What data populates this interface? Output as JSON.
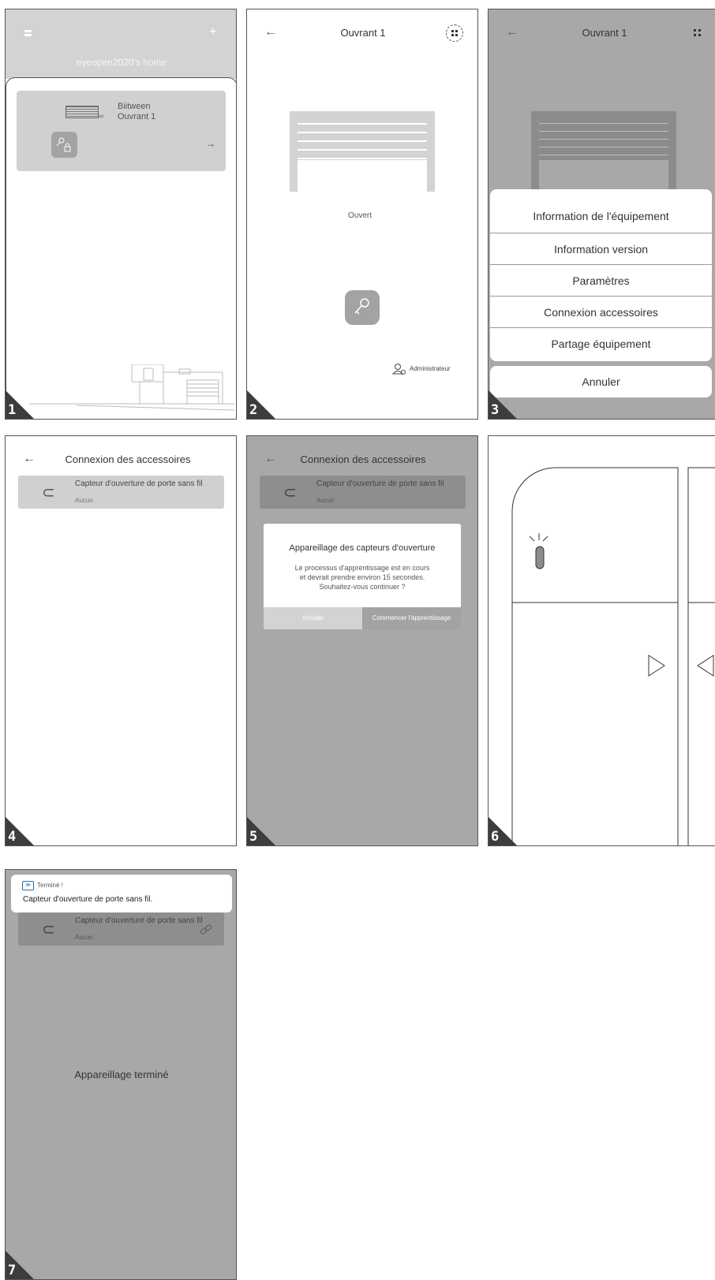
{
  "panels": [
    {
      "number": "1"
    },
    {
      "number": "2"
    },
    {
      "number": "3"
    },
    {
      "number": "4"
    },
    {
      "number": "5"
    },
    {
      "number": "6"
    },
    {
      "number": "7"
    }
  ],
  "screen1": {
    "home_title": "eyeopen2020's home",
    "device_brand": "Biitween",
    "device_name": "Ouvrant 1",
    "arrow": "→"
  },
  "screen2": {
    "back": "←",
    "title": "Ouvrant 1",
    "status": "Ouvert",
    "admin_label": "Administrateur"
  },
  "screen3": {
    "back": "←",
    "title": "Ouvrant 1",
    "menu": [
      "Information de l'équipement",
      "Information version",
      "Paramètres",
      "Connexion accessoires",
      "Partage équipement"
    ],
    "cancel": "Annuler"
  },
  "screen4": {
    "back": "←",
    "title": "Connexion des accessoires",
    "item_name": "Capteur d'ouverture de porte sans fil",
    "item_status": "Aucun"
  },
  "screen5": {
    "back": "←",
    "title": "Connexion des accessoires",
    "item_name": "Capteur d'ouverture de porte sans fil",
    "item_status": "Aucun",
    "dialog_title": "Appareillage des capteurs d'ouverture",
    "dialog_line1": "Le processus d'apprentissage est en cours",
    "dialog_line2": "et devrait prendre environ 15 secondes.",
    "dialog_line3": "Souhaitez-vous continuer ?",
    "cancel": "Annuler",
    "start": "Commencer l'apprentissage"
  },
  "screen7": {
    "notif_title": "Terminé !",
    "notif_body": "Capteur d'ouverture de porte sans fil.",
    "item_name": "Capteur d'ouverture de porte sans fil",
    "item_status": "Aucun",
    "done": "Appareillage terminé"
  }
}
